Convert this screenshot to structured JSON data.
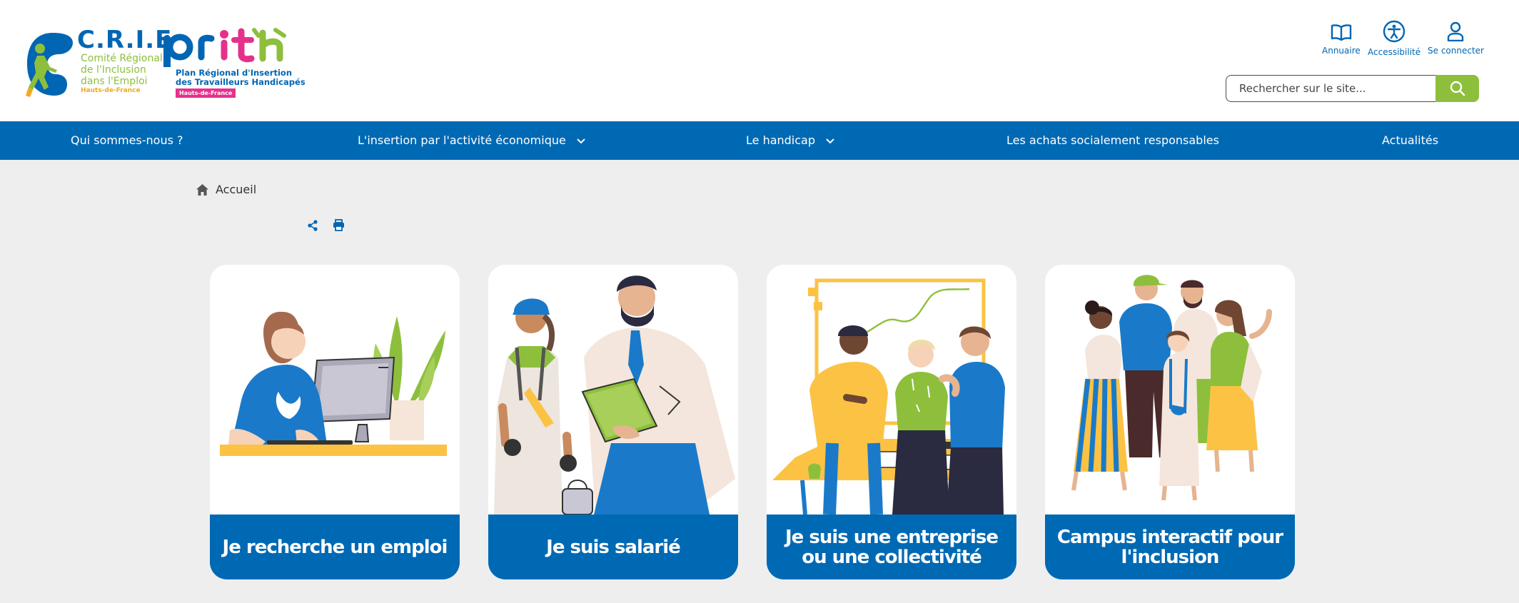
{
  "logo": {
    "crie_name": "C.R.I.E",
    "crie_lines": [
      "Comité Régional",
      "de l'Inclusion",
      "dans l'Emploi"
    ],
    "crie_region": "Hauts-de-France",
    "prith_name": "prith",
    "prith_lines": [
      "Plan Régional d'Insertion",
      "des Travailleurs Handicapés"
    ],
    "prith_region": "Hauts-de-France"
  },
  "tools": {
    "annuaire": "Annuaire",
    "accessibilite": "Accessibilité",
    "connexion": "Se connecter"
  },
  "search": {
    "placeholder": "Rechercher sur le site..."
  },
  "nav": [
    {
      "label": "Qui sommes-nous ?"
    },
    {
      "label": "L'insertion par l'activité économique"
    },
    {
      "label": "Le handicap"
    },
    {
      "label": "Les achats socialement responsables"
    },
    {
      "label": "Actualités"
    }
  ],
  "breadcrumb": {
    "home": "Accueil"
  },
  "cards": [
    {
      "label": "Je recherche un emploi"
    },
    {
      "label": "Je suis salarié"
    },
    {
      "label": "Je suis une entreprise ou une collectivité"
    },
    {
      "label": "Campus interactif pour l'inclusion"
    }
  ],
  "colors": {
    "brand_blue": "#0069b4",
    "brand_green": "#8dbf3d",
    "brand_pink": "#e5318c",
    "brand_orange": "#f2a81d",
    "background": "#eeeeee"
  }
}
